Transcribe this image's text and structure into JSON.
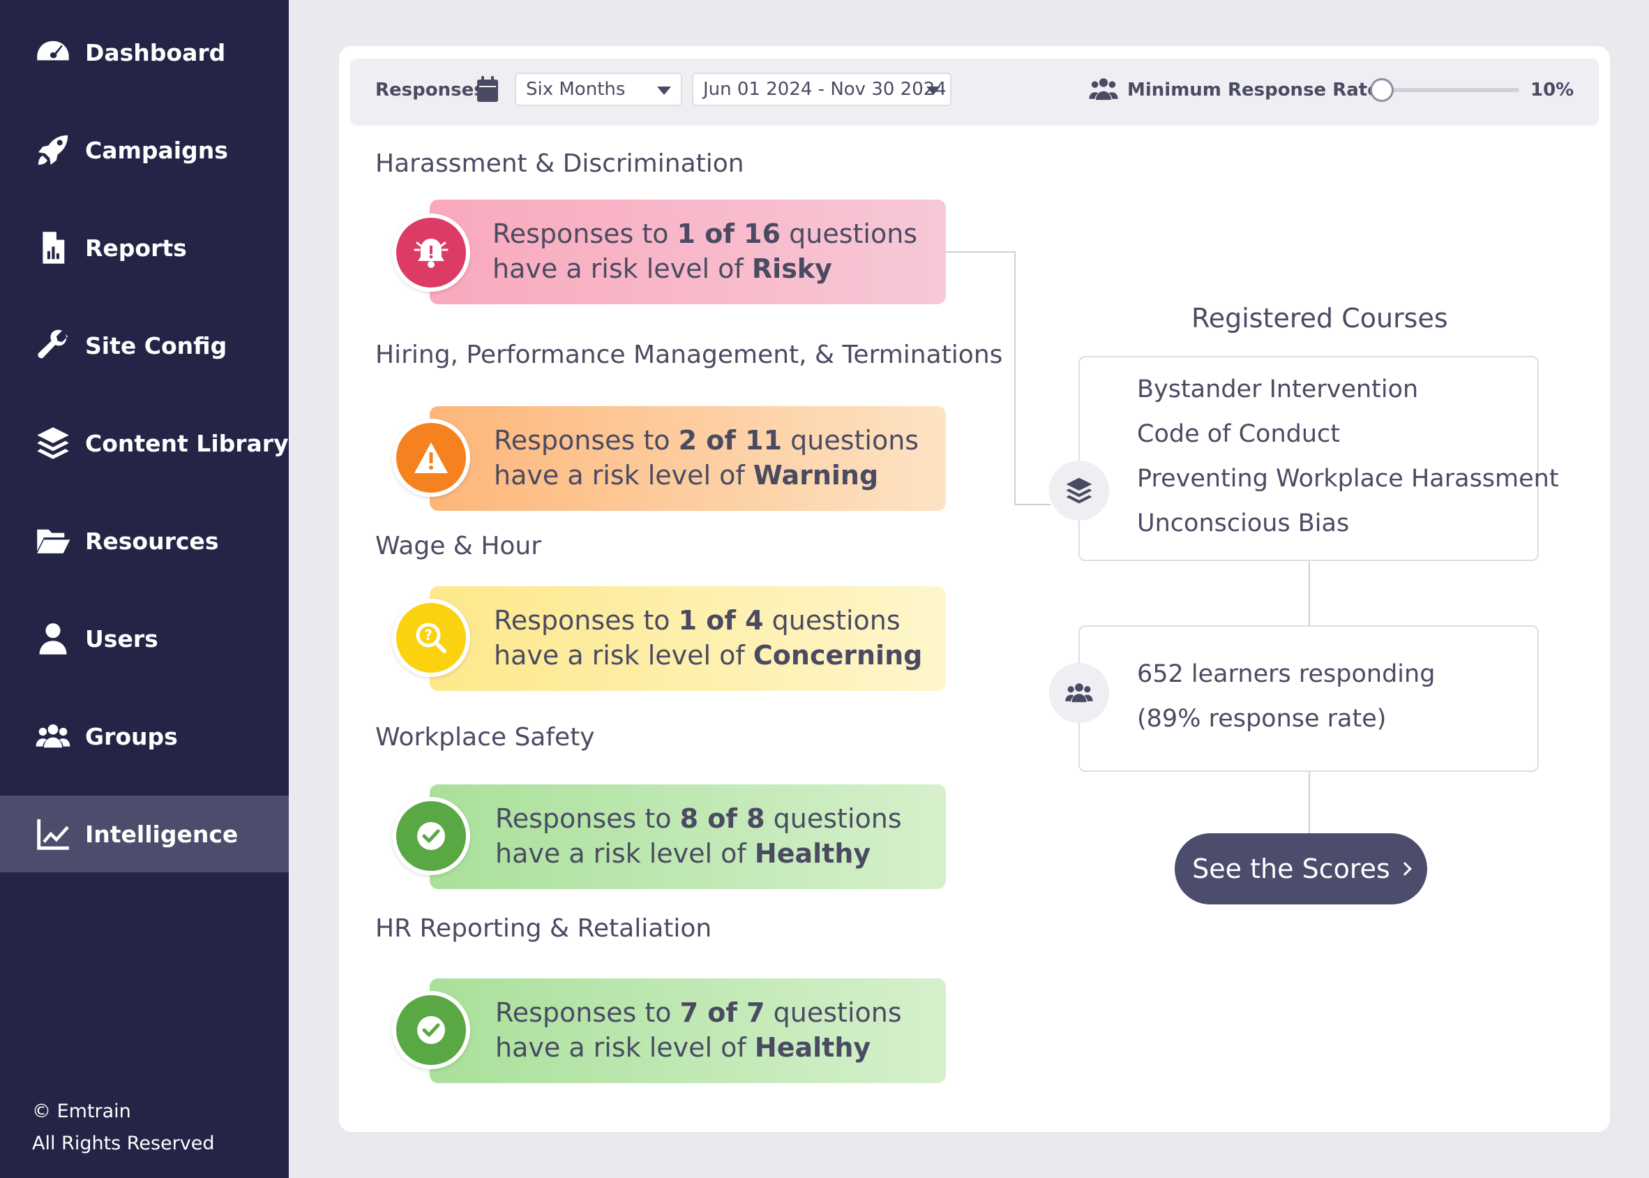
{
  "sidebar": {
    "items": [
      {
        "label": "Dashboard",
        "icon": "dashboard-icon"
      },
      {
        "label": "Campaigns",
        "icon": "rocket-icon"
      },
      {
        "label": "Reports",
        "icon": "report-icon"
      },
      {
        "label": "Site Config",
        "icon": "wrench-icon"
      },
      {
        "label": "Content Library",
        "icon": "layers-icon"
      },
      {
        "label": "Resources",
        "icon": "folder-icon"
      },
      {
        "label": "Users",
        "icon": "user-icon"
      },
      {
        "label": "Groups",
        "icon": "groups-icon"
      },
      {
        "label": "Intelligence",
        "icon": "chart-line-icon",
        "active": true
      }
    ],
    "footer_line1": "© Emtrain",
    "footer_line2": "All Rights Reserved"
  },
  "toolbar": {
    "responses_label": "Responses",
    "period_value": "Six Months",
    "date_range_value": "Jun 01 2024 - Nov 30 2024",
    "min_rate_label": "Minimum Response Rate",
    "min_rate_value": "10%",
    "min_rate_level": 0.0
  },
  "categories": [
    {
      "title": "Harassment & Discrimination",
      "prefix": "Responses to ",
      "count": "1 of 16",
      "suffix": " questions",
      "line2_prefix": "have a risk level of ",
      "level": "Risky",
      "color": "#dc3b66"
    },
    {
      "title": "Hiring, Performance Management, & Terminations",
      "prefix": "Responses to ",
      "count": "2 of 11",
      "suffix": " questions",
      "line2_prefix": "have a risk level of ",
      "level": "Warning",
      "color": "#f5821f"
    },
    {
      "title": "Wage & Hour",
      "prefix": "Responses to ",
      "count": "1 of 4",
      "suffix": " questions",
      "line2_prefix": "have a risk level of ",
      "level": "Concerning",
      "color": "#fbd20f"
    },
    {
      "title": "Workplace Safety",
      "prefix": "Responses to ",
      "count": "8 of 8",
      "suffix": " questions",
      "line2_prefix": "have a risk level of ",
      "level": "Healthy",
      "color": "#5aa844"
    },
    {
      "title": "HR Reporting & Retaliation",
      "prefix": "Responses to ",
      "count": "7 of 7",
      "suffix": " questions",
      "line2_prefix": "have a risk level of ",
      "level": "Healthy",
      "color": "#5aa844"
    }
  ],
  "registered_courses": {
    "title": "Registered Courses",
    "courses": [
      "Bystander Intervention",
      "Code of Conduct",
      "Preventing Workplace Harassment",
      "Unconscious Bias"
    ]
  },
  "learners": {
    "line1": "652 learners responding",
    "line2": "(89% response rate)"
  },
  "see_scores_label": "See the Scores"
}
